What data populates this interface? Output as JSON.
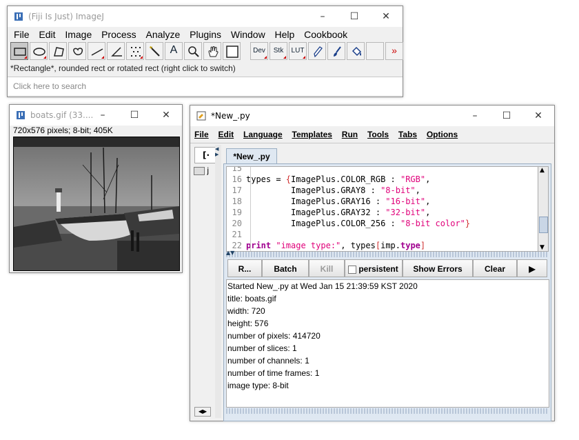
{
  "imagej": {
    "title": "(Fiji Is Just) ImageJ",
    "menu": [
      "File",
      "Edit",
      "Image",
      "Process",
      "Analyze",
      "Plugins",
      "Window",
      "Help",
      "Cookbook"
    ],
    "tools": {
      "text": "A",
      "dev": "Dev",
      "stk": "Stk",
      "lut": "LUT",
      "more": "»"
    },
    "status": "*Rectangle*, rounded rect or rotated rect (right click to switch)",
    "search_placeholder": "Click here to search"
  },
  "boats": {
    "title": "boats.gif (33....",
    "info": "720x576 pixels; 8-bit; 405K"
  },
  "editor": {
    "title": "*New_.py",
    "menu": [
      "File",
      "Edit",
      "Language",
      "Templates",
      "Run",
      "Tools",
      "Tabs",
      "Options"
    ],
    "tab": "*New_.py",
    "side_tab": "[·",
    "side_item": "j",
    "line_numbers": [
      "15",
      "16",
      "17",
      "18",
      "19",
      "20",
      "21",
      "22"
    ],
    "code": {
      "l16_a": "types = ",
      "l16_b": "{",
      "l16_c": "ImagePlus.COLOR_RGB : ",
      "l16_d": "\"RGB\"",
      "l16_e": ",",
      "l17_a": "         ImagePlus.GRAY8 : ",
      "l17_b": "\"8-bit\"",
      "l17_c": ",",
      "l18_a": "         ImagePlus.GRAY16 : ",
      "l18_b": "\"16-bit\"",
      "l18_c": ",",
      "l19_a": "         ImagePlus.GRAY32 : ",
      "l19_b": "\"32-bit\"",
      "l19_c": ",",
      "l20_a": "         ImagePlus.COLOR_256 : ",
      "l20_b": "\"8-bit color\"",
      "l20_c": "}",
      "l22_a": "print",
      "l22_b": " ",
      "l22_c": "\"image type:\"",
      "l22_d": ", types",
      "l22_e": "[",
      "l22_f": "imp.",
      "l22_g": "type",
      "l22_h": "]"
    },
    "buttons": {
      "run": "R...",
      "batch": "Batch",
      "kill": "Kill",
      "persistent": "persistent",
      "show_errors": "Show Errors",
      "clear": "Clear",
      "more": "▶"
    },
    "output": [
      "Started New_.py at Wed Jan 15 21:39:59 KST 2020",
      "title: boats.gif",
      "width: 720",
      "height: 576",
      "number of pixels: 414720",
      "number of slices: 1",
      "number of channels: 1",
      "number of time frames: 1",
      "image type: 8-bit"
    ]
  }
}
